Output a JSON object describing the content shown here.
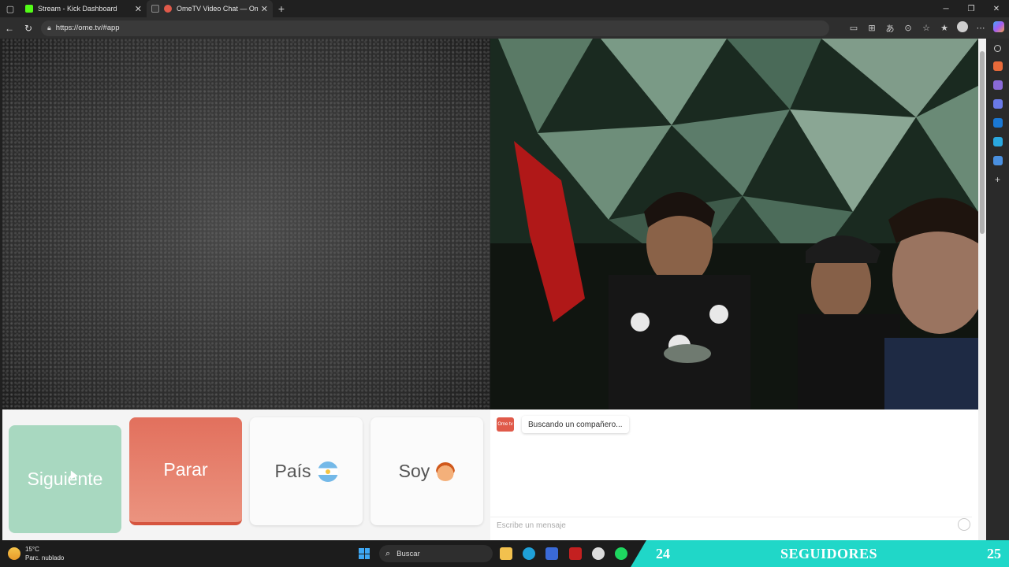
{
  "browser": {
    "tabs": [
      {
        "label": "Stream - Kick Dashboard",
        "favicon_color": "#53fc18",
        "active": false
      },
      {
        "label": "OmeTV Video Chat — Omeg",
        "favicon_color": "#e05a4a",
        "active": true
      }
    ],
    "url": "https://ome.tv/#app"
  },
  "controls": {
    "next_label": "Siguiente",
    "stop_label": "Parar",
    "country_label": "País",
    "gender_label": "Soy"
  },
  "chat": {
    "logo_text": "Ome tv",
    "status_message": "Buscando un compañero...",
    "input_placeholder": "Escribe un mensaje"
  },
  "taskbar": {
    "weather_temp": "15°C",
    "weather_desc": "Parc. nublado",
    "search_label": "Buscar"
  },
  "overlay": {
    "left_count": "24",
    "label": "SEGUIDORES",
    "right_count": "25"
  }
}
